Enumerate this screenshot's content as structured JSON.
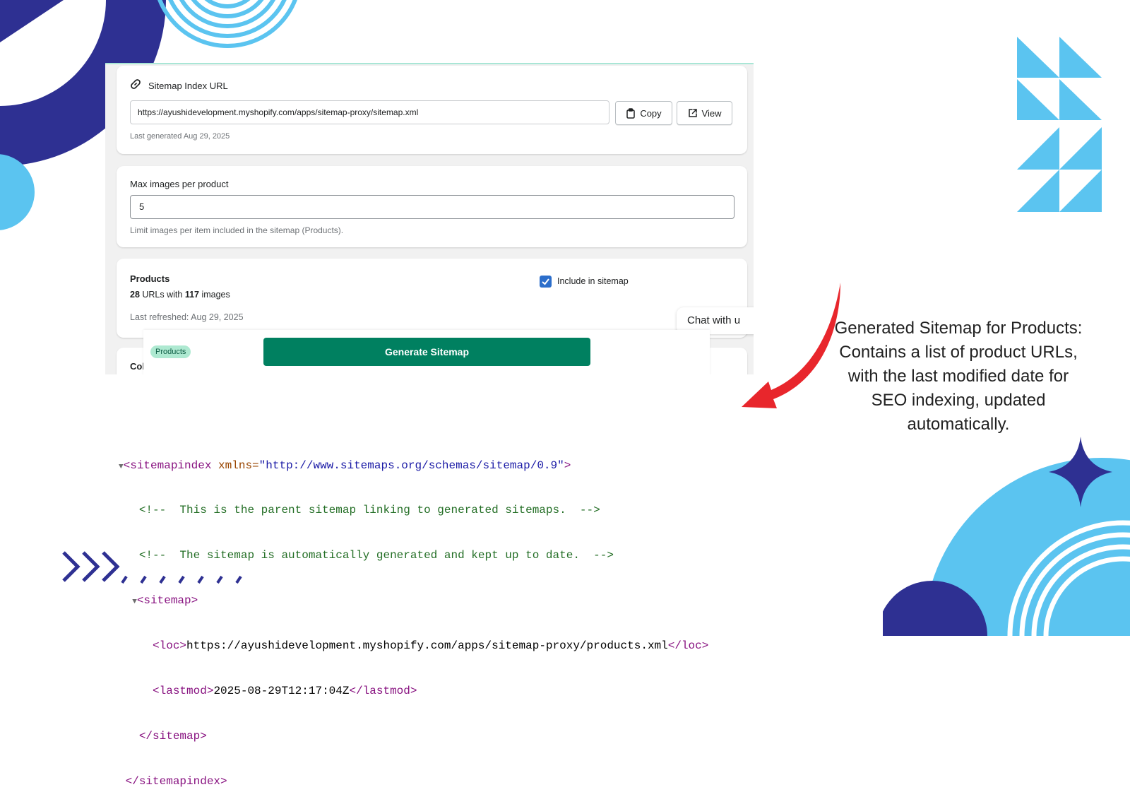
{
  "card_url": {
    "title": "Sitemap Index URL",
    "url_value": "https://ayushidevelopment.myshopify.com/apps/sitemap-proxy/sitemap.xml",
    "copy_label": "Copy",
    "view_label": "View",
    "last_generated": "Last generated Aug 29, 2025"
  },
  "card_images": {
    "label": "Max images per product",
    "value": "5",
    "help": "Limit images per item included in the sitemap (Products)."
  },
  "card_products": {
    "title": "Products",
    "url_count": "28",
    "urls_with": " URLs with ",
    "image_count": "117",
    "images_word": " images",
    "include_label": "Include in sitemap",
    "include_checked": true,
    "last_refreshed": "Last refreshed: Aug 29, 2025"
  },
  "card_partial": {
    "label": "Col"
  },
  "chat": {
    "label": "Chat with u"
  },
  "bottom_bar": {
    "tag": "Products",
    "generate_label": "Generate Sitemap"
  },
  "xml": {
    "open_tag": "<sitemapindex",
    "xmlns_attr": " xmlns=",
    "xmlns_val": "\"http://www.sitemaps.org/schemas/sitemap/0.9\"",
    "open_end": ">",
    "comment1": "<!--  This is the parent sitemap linking to generated sitemaps.  -->",
    "comment2": "<!--  The sitemap is automatically generated and kept up to date.  -->",
    "sitemap_open": "<sitemap>",
    "loc_open": "<loc>",
    "loc_text": "https://ayushidevelopment.myshopify.com/apps/sitemap-proxy/products.xml",
    "loc_close": "</loc>",
    "lastmod_open": "<lastmod>",
    "lastmod_text": "2025-08-29T12:17:04Z",
    "lastmod_close": "</lastmod>",
    "sitemap_close": "</sitemap>",
    "index_close": "</sitemapindex>"
  },
  "caption": {
    "lines": [
      "Generated Sitemap for Products:",
      "Contains a list of product URLs,",
      "with the last modified date for",
      "SEO indexing, updated",
      "automatically."
    ]
  },
  "colors": {
    "navy": "#2e3092",
    "sky": "#5bc4f0",
    "arrow_red": "#e8262c",
    "shopify_green": "#008060",
    "checkbox_blue": "#2c6ecb"
  },
  "icons": [
    "link-icon",
    "clipboard-icon",
    "external-link-icon",
    "check-icon",
    "expand-triangle-icon",
    "curved-arrow-icon"
  ]
}
